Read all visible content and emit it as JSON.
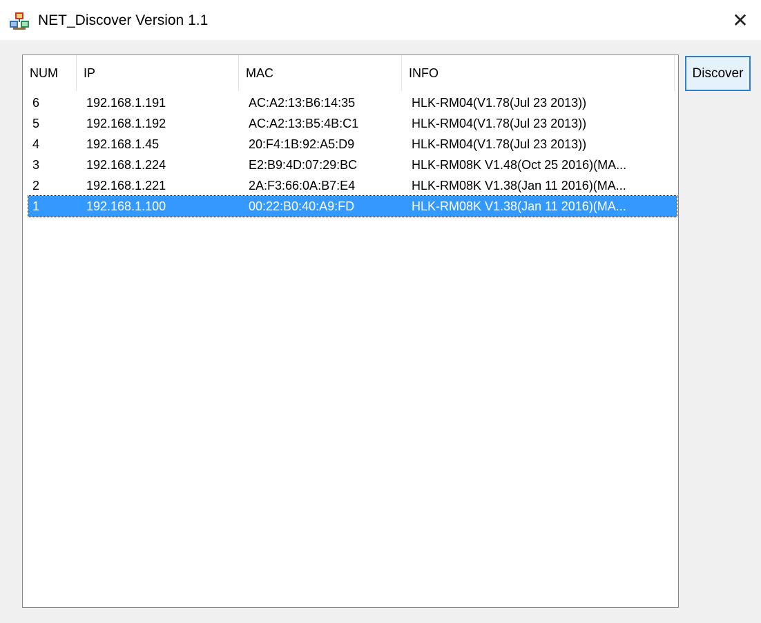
{
  "window": {
    "title": "NET_Discover Version 1.1",
    "close_glyph": "✕",
    "app_icon": "network-app-icon",
    "close_icon": "close-icon"
  },
  "colors": {
    "selection": "#3399ff",
    "button_border": "#2a7fd4",
    "button_fill": "#e5f1fb"
  },
  "table": {
    "columns": [
      "NUM",
      "IP",
      "MAC",
      "INFO"
    ],
    "rows": [
      {
        "num": "6",
        "ip": "192.168.1.191",
        "mac": "AC:A2:13:B6:14:35",
        "info": "HLK-RM04(V1.78(Jul 23 2013))"
      },
      {
        "num": "5",
        "ip": "192.168.1.192",
        "mac": "AC:A2:13:B5:4B:C1",
        "info": "HLK-RM04(V1.78(Jul 23 2013))"
      },
      {
        "num": "4",
        "ip": "192.168.1.45",
        "mac": "20:F4:1B:92:A5:D9",
        "info": "HLK-RM04(V1.78(Jul 23 2013))"
      },
      {
        "num": "3",
        "ip": "192.168.1.224",
        "mac": "E2:B9:4D:07:29:BC",
        "info": "HLK-RM08K V1.48(Oct 25 2016)(MA..."
      },
      {
        "num": "2",
        "ip": "192.168.1.221",
        "mac": "2A:F3:66:0A:B7:E4",
        "info": "HLK-RM08K V1.38(Jan 11 2016)(MA..."
      },
      {
        "num": "1",
        "ip": "192.168.1.100",
        "mac": "00:22:B0:40:A9:FD",
        "info": "HLK-RM08K V1.38(Jan 11 2016)(MA...",
        "selected": true
      }
    ]
  },
  "buttons": {
    "discover_label": "Discover"
  }
}
